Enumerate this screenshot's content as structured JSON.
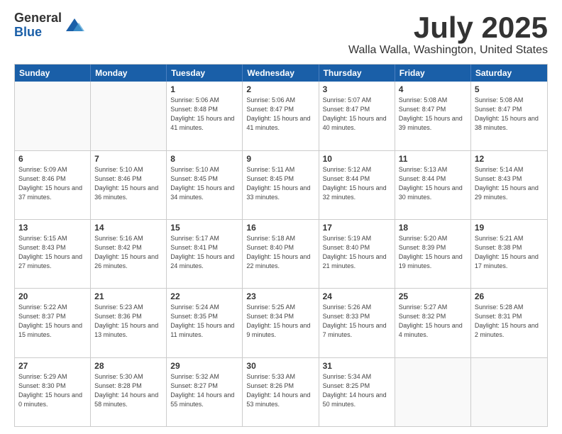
{
  "logo": {
    "general": "General",
    "blue": "Blue"
  },
  "header": {
    "month": "July 2025",
    "location": "Walla Walla, Washington, United States"
  },
  "weekdays": [
    "Sunday",
    "Monday",
    "Tuesday",
    "Wednesday",
    "Thursday",
    "Friday",
    "Saturday"
  ],
  "weeks": [
    [
      {
        "day": "",
        "empty": true
      },
      {
        "day": "",
        "empty": true
      },
      {
        "day": "1",
        "sunrise": "Sunrise: 5:06 AM",
        "sunset": "Sunset: 8:48 PM",
        "daylight": "Daylight: 15 hours and 41 minutes."
      },
      {
        "day": "2",
        "sunrise": "Sunrise: 5:06 AM",
        "sunset": "Sunset: 8:47 PM",
        "daylight": "Daylight: 15 hours and 41 minutes."
      },
      {
        "day": "3",
        "sunrise": "Sunrise: 5:07 AM",
        "sunset": "Sunset: 8:47 PM",
        "daylight": "Daylight: 15 hours and 40 minutes."
      },
      {
        "day": "4",
        "sunrise": "Sunrise: 5:08 AM",
        "sunset": "Sunset: 8:47 PM",
        "daylight": "Daylight: 15 hours and 39 minutes."
      },
      {
        "day": "5",
        "sunrise": "Sunrise: 5:08 AM",
        "sunset": "Sunset: 8:47 PM",
        "daylight": "Daylight: 15 hours and 38 minutes."
      }
    ],
    [
      {
        "day": "6",
        "sunrise": "Sunrise: 5:09 AM",
        "sunset": "Sunset: 8:46 PM",
        "daylight": "Daylight: 15 hours and 37 minutes."
      },
      {
        "day": "7",
        "sunrise": "Sunrise: 5:10 AM",
        "sunset": "Sunset: 8:46 PM",
        "daylight": "Daylight: 15 hours and 36 minutes."
      },
      {
        "day": "8",
        "sunrise": "Sunrise: 5:10 AM",
        "sunset": "Sunset: 8:45 PM",
        "daylight": "Daylight: 15 hours and 34 minutes."
      },
      {
        "day": "9",
        "sunrise": "Sunrise: 5:11 AM",
        "sunset": "Sunset: 8:45 PM",
        "daylight": "Daylight: 15 hours and 33 minutes."
      },
      {
        "day": "10",
        "sunrise": "Sunrise: 5:12 AM",
        "sunset": "Sunset: 8:44 PM",
        "daylight": "Daylight: 15 hours and 32 minutes."
      },
      {
        "day": "11",
        "sunrise": "Sunrise: 5:13 AM",
        "sunset": "Sunset: 8:44 PM",
        "daylight": "Daylight: 15 hours and 30 minutes."
      },
      {
        "day": "12",
        "sunrise": "Sunrise: 5:14 AM",
        "sunset": "Sunset: 8:43 PM",
        "daylight": "Daylight: 15 hours and 29 minutes."
      }
    ],
    [
      {
        "day": "13",
        "sunrise": "Sunrise: 5:15 AM",
        "sunset": "Sunset: 8:43 PM",
        "daylight": "Daylight: 15 hours and 27 minutes."
      },
      {
        "day": "14",
        "sunrise": "Sunrise: 5:16 AM",
        "sunset": "Sunset: 8:42 PM",
        "daylight": "Daylight: 15 hours and 26 minutes."
      },
      {
        "day": "15",
        "sunrise": "Sunrise: 5:17 AM",
        "sunset": "Sunset: 8:41 PM",
        "daylight": "Daylight: 15 hours and 24 minutes."
      },
      {
        "day": "16",
        "sunrise": "Sunrise: 5:18 AM",
        "sunset": "Sunset: 8:40 PM",
        "daylight": "Daylight: 15 hours and 22 minutes."
      },
      {
        "day": "17",
        "sunrise": "Sunrise: 5:19 AM",
        "sunset": "Sunset: 8:40 PM",
        "daylight": "Daylight: 15 hours and 21 minutes."
      },
      {
        "day": "18",
        "sunrise": "Sunrise: 5:20 AM",
        "sunset": "Sunset: 8:39 PM",
        "daylight": "Daylight: 15 hours and 19 minutes."
      },
      {
        "day": "19",
        "sunrise": "Sunrise: 5:21 AM",
        "sunset": "Sunset: 8:38 PM",
        "daylight": "Daylight: 15 hours and 17 minutes."
      }
    ],
    [
      {
        "day": "20",
        "sunrise": "Sunrise: 5:22 AM",
        "sunset": "Sunset: 8:37 PM",
        "daylight": "Daylight: 15 hours and 15 minutes."
      },
      {
        "day": "21",
        "sunrise": "Sunrise: 5:23 AM",
        "sunset": "Sunset: 8:36 PM",
        "daylight": "Daylight: 15 hours and 13 minutes."
      },
      {
        "day": "22",
        "sunrise": "Sunrise: 5:24 AM",
        "sunset": "Sunset: 8:35 PM",
        "daylight": "Daylight: 15 hours and 11 minutes."
      },
      {
        "day": "23",
        "sunrise": "Sunrise: 5:25 AM",
        "sunset": "Sunset: 8:34 PM",
        "daylight": "Daylight: 15 hours and 9 minutes."
      },
      {
        "day": "24",
        "sunrise": "Sunrise: 5:26 AM",
        "sunset": "Sunset: 8:33 PM",
        "daylight": "Daylight: 15 hours and 7 minutes."
      },
      {
        "day": "25",
        "sunrise": "Sunrise: 5:27 AM",
        "sunset": "Sunset: 8:32 PM",
        "daylight": "Daylight: 15 hours and 4 minutes."
      },
      {
        "day": "26",
        "sunrise": "Sunrise: 5:28 AM",
        "sunset": "Sunset: 8:31 PM",
        "daylight": "Daylight: 15 hours and 2 minutes."
      }
    ],
    [
      {
        "day": "27",
        "sunrise": "Sunrise: 5:29 AM",
        "sunset": "Sunset: 8:30 PM",
        "daylight": "Daylight: 15 hours and 0 minutes."
      },
      {
        "day": "28",
        "sunrise": "Sunrise: 5:30 AM",
        "sunset": "Sunset: 8:28 PM",
        "daylight": "Daylight: 14 hours and 58 minutes."
      },
      {
        "day": "29",
        "sunrise": "Sunrise: 5:32 AM",
        "sunset": "Sunset: 8:27 PM",
        "daylight": "Daylight: 14 hours and 55 minutes."
      },
      {
        "day": "30",
        "sunrise": "Sunrise: 5:33 AM",
        "sunset": "Sunset: 8:26 PM",
        "daylight": "Daylight: 14 hours and 53 minutes."
      },
      {
        "day": "31",
        "sunrise": "Sunrise: 5:34 AM",
        "sunset": "Sunset: 8:25 PM",
        "daylight": "Daylight: 14 hours and 50 minutes."
      },
      {
        "day": "",
        "empty": true
      },
      {
        "day": "",
        "empty": true
      }
    ]
  ]
}
